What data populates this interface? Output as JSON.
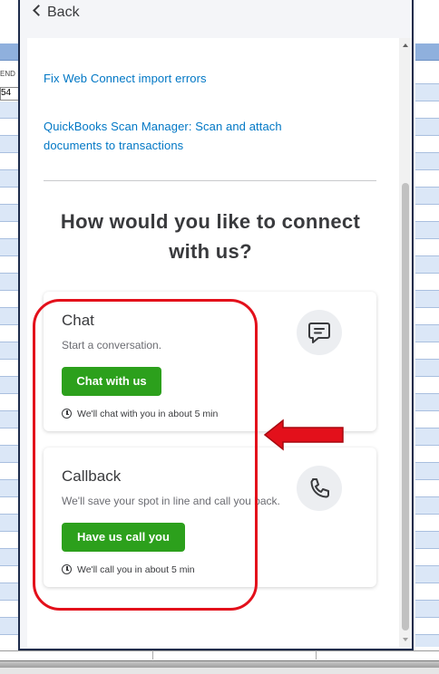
{
  "background": {
    "column_header_fragment": "END",
    "cell_value_fragment": "54"
  },
  "panel": {
    "back_label": "Back",
    "links": [
      "Fix Web Connect import errors",
      "QuickBooks Scan Manager: Scan and attach",
      "documents to transactions"
    ],
    "heading_line1": "How would you like to connect",
    "heading_line2": "with us?",
    "chat": {
      "title": "Chat",
      "subtitle": "Start a conversation.",
      "button": "Chat with us",
      "eta": "We'll chat with you in about 5 min",
      "icon": "chat-icon"
    },
    "callback": {
      "title": "Callback",
      "subtitle": "We'll save your spot in line and call you back.",
      "button": "Have us call you",
      "eta": "We'll call you in about 5 min",
      "icon": "phone-icon"
    }
  },
  "colors": {
    "brand_green": "#2ca01c",
    "link_blue": "#0077c5",
    "annotation_red": "#e3101b",
    "panel_border": "#1d2b4a"
  }
}
